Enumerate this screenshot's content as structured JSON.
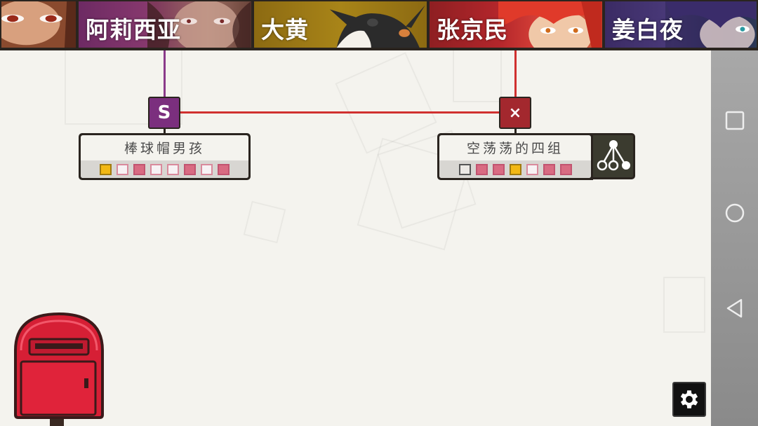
{
  "characters": [
    {
      "name": "",
      "color": "#c47a5a"
    },
    {
      "name": "阿莉西亚",
      "color": "#8a3a6f"
    },
    {
      "name": "大黄",
      "color": "#a88418"
    },
    {
      "name": "张京民",
      "color": "#b3262b"
    },
    {
      "name": "姜白夜",
      "color": "#4a3a7a"
    }
  ],
  "nodes": [
    {
      "marker": "S",
      "marker_color": "#7b2f7e",
      "title": "棒球帽男孩",
      "slots": [
        "gold",
        "empty",
        "filled",
        "empty",
        "empty",
        "filled",
        "empty",
        "filled"
      ]
    },
    {
      "marker": "×",
      "marker_color": "#a3282e",
      "title": "空荡荡的四组",
      "slots": [
        "dark-empty",
        "filled",
        "filled",
        "gold",
        "empty",
        "filled",
        "filled"
      ],
      "has_branch_icon": true
    }
  ],
  "line_colors": {
    "purple": "#8a3a8a",
    "red": "#d0302f"
  },
  "icons": {
    "mailbox": "mailbox-icon",
    "settings": "gear-icon",
    "zoom_out": "zoom-out-icon",
    "branch": "branch-tree-icon",
    "nav": [
      "square-icon",
      "circle-icon",
      "back-triangle-icon"
    ]
  }
}
